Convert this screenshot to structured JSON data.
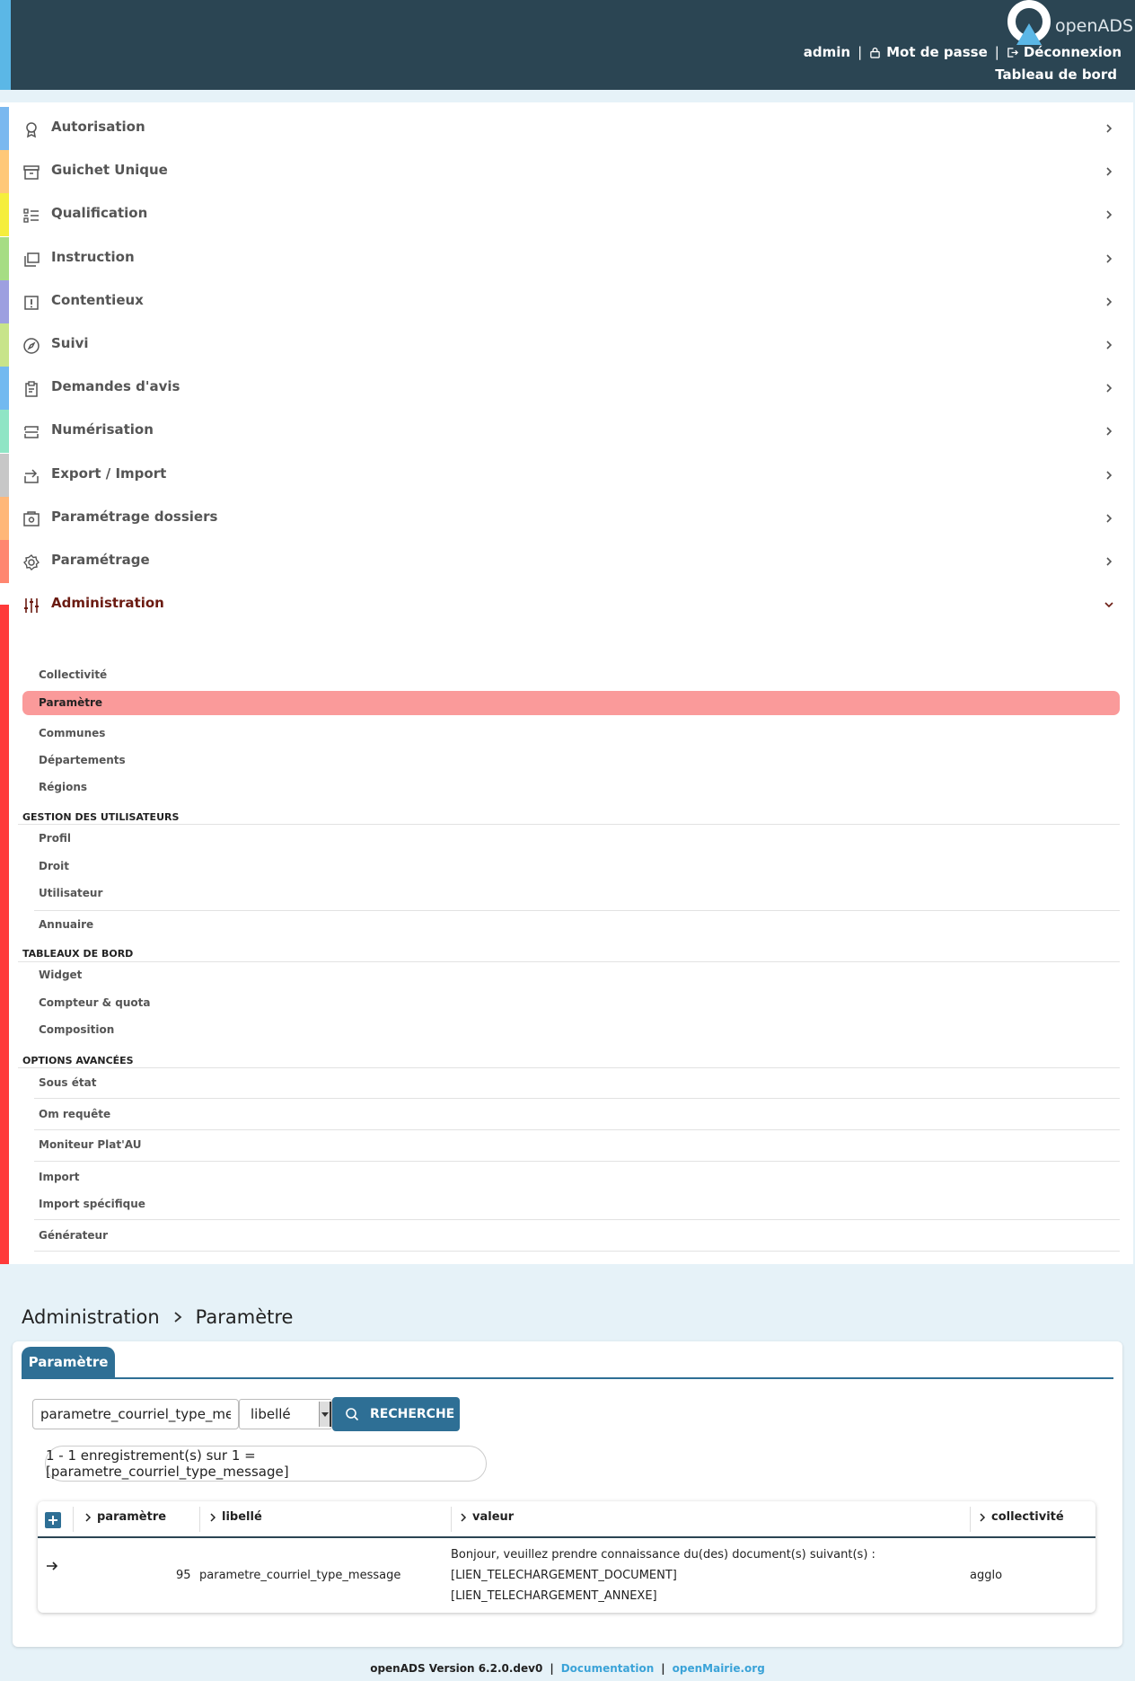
{
  "header": {
    "logo_text": "openADS",
    "user": "admin",
    "password_link": "Mot de passe",
    "logout_link": "Déconnexion",
    "dashboard_link": "Tableau de bord",
    "separator": "|"
  },
  "menu": {
    "items": [
      {
        "label": "Autorisation",
        "color": "#7ab8ef",
        "icon": "award-icon"
      },
      {
        "label": "Guichet Unique",
        "color": "#ffc878",
        "icon": "archive-icon"
      },
      {
        "label": "Qualification",
        "color": "#f5ee3c",
        "icon": "checklist-icon"
      },
      {
        "label": "Instruction",
        "color": "#a6dd84",
        "icon": "stack-icon"
      },
      {
        "label": "Contentieux",
        "color": "#9d9fe0",
        "icon": "alert-box-icon"
      },
      {
        "label": "Suivi",
        "color": "#c8e48a",
        "icon": "compass-icon"
      },
      {
        "label": "Demandes d'avis",
        "color": "#72b9f0",
        "icon": "clipboard-icon"
      },
      {
        "label": "Numérisation",
        "color": "#8fe5c5",
        "icon": "scanner-icon"
      },
      {
        "label": "Export / Import",
        "color": "#c7c7c7",
        "icon": "export-icon"
      },
      {
        "label": "Paramétrage dossiers",
        "color": "#ffb778",
        "icon": "folder-settings-icon"
      },
      {
        "label": "Paramétrage",
        "color": "#ff8670",
        "icon": "gear-icon"
      },
      {
        "label": "Administration",
        "color": "#ff3a3a",
        "icon": "sliders-icon"
      }
    ],
    "admin_sub": {
      "collectivite": "Collectivité",
      "parametre": "Paramètre",
      "communes": "Communes",
      "departements": "Départements",
      "regions": "Régions",
      "section_users": "GESTION DES UTILISATEURS",
      "profil": "Profil",
      "droit": "Droit",
      "utilisateur": "Utilisateur",
      "annuaire": "Annuaire",
      "section_dashboards": "TABLEAUX DE BORD",
      "widget": "Widget",
      "compteur": "Compteur & quota",
      "composition": "Composition",
      "section_advanced": "OPTIONS AVANCÉES",
      "sous_etat": "Sous état",
      "om_requete": "Om requête",
      "moniteur": "Moniteur Plat'AU",
      "import": "Import",
      "import_specifique": "Import spécifique",
      "generateur": "Générateur"
    }
  },
  "breadcrumb": {
    "parent": "Administration",
    "current": "Paramètre"
  },
  "tab": {
    "label": "Paramètre"
  },
  "search": {
    "value": "parametre_courriel_type_message",
    "field_selected": "libellé",
    "button_label": "RECHERCHE"
  },
  "pagination": {
    "text": "1 - 1 enregistrement(s) sur 1 = [parametre_courriel_type_message]"
  },
  "table": {
    "columns": [
      "paramètre",
      "libellé",
      "valeur",
      "collectivité"
    ],
    "rows": [
      {
        "parametre": "95",
        "libelle": "parametre_courriel_type_message",
        "valeur_line1": "Bonjour, veuillez prendre connaissance du(des) document(s) suivant(s) :",
        "valeur_line2": "[LIEN_TELECHARGEMENT_DOCUMENT]",
        "valeur_line3": "[LIEN_TELECHARGEMENT_ANNEXE]",
        "collectivite": "agglo"
      }
    ]
  },
  "footer": {
    "version": "openADS Version 6.2.0.dev0",
    "documentation": "Documentation",
    "openmairie": "openMairie.org",
    "separator": "|"
  }
}
